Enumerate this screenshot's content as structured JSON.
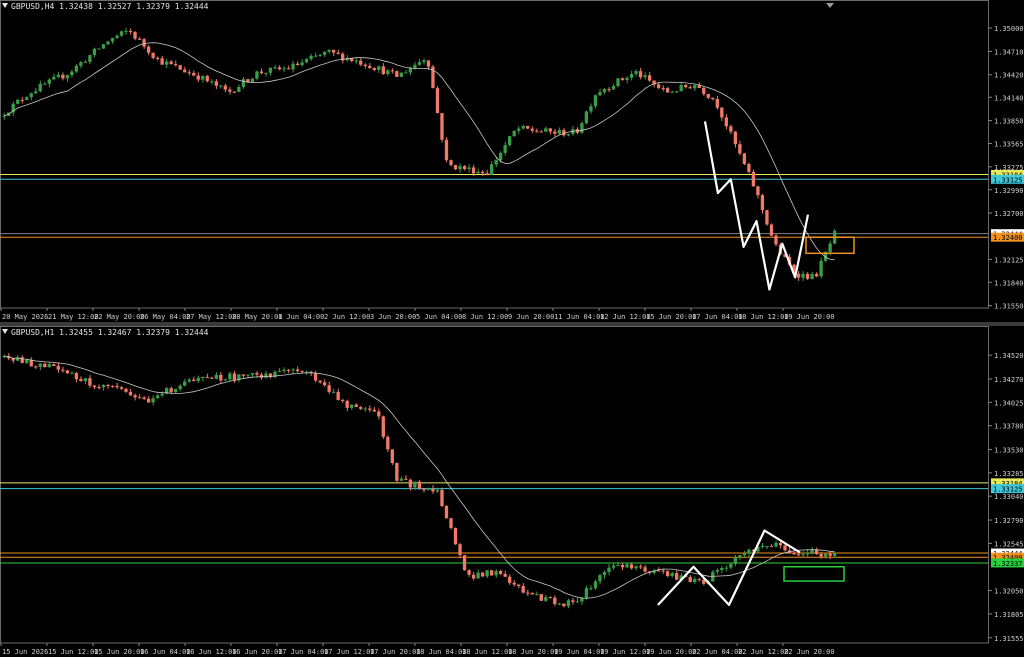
{
  "colors": {
    "background": "#000000",
    "bull": "#3a9e48",
    "bear": "#f07a67",
    "ma": "#c8c8c8",
    "axis_text": "#cfcfcf",
    "yellow": "#e8e85a",
    "cyan": "#3ec8d8",
    "orange": "#f0901e",
    "green": "#28d040",
    "white": "#ffffff"
  },
  "panes": [
    {
      "id": "h4",
      "header": "GBPUSD,H4  1.32438 1.32527 1.32379 1.32444",
      "symbol": "GBPUSD",
      "timeframe": "H4",
      "ohlc": [
        "1.32438",
        "1.32527",
        "1.32379",
        "1.32444"
      ],
      "y_min": 1.3152,
      "y_max": 1.352,
      "price_ticks": [
        "1.35000",
        "1.34710",
        "1.34420",
        "1.34140",
        "1.33850",
        "1.33565",
        "1.33275",
        "1.32990",
        "1.32700",
        "1.32125",
        "1.31840",
        "1.31550"
      ],
      "price_labels": [
        {
          "price": 1.3318,
          "text": "1.33184",
          "color": "#e8e85a"
        },
        {
          "price": 1.3312,
          "text": "1.33125",
          "color": "#3ec8d8"
        },
        {
          "price": 1.32444,
          "text": "1.32444",
          "color": "#ffffff"
        },
        {
          "price": 1.324,
          "text": "1.32400",
          "color": "#f0901e"
        }
      ],
      "hlines": [
        {
          "price": 1.3318,
          "color": "#e8e85a"
        },
        {
          "price": 1.3312,
          "color": "#3ec8d8"
        },
        {
          "price": 1.32444,
          "color": "#808080"
        },
        {
          "price": 1.324,
          "color": "#f0901e"
        }
      ],
      "time_labels": [
        "20 May 2026",
        "21 May 12:00",
        "22 May 20:00",
        "26 May 04:00",
        "27 May 12:00",
        "28 May 20:00",
        "1 Jun 04:00",
        "2 Jun 12:00",
        "3 Jun 20:00",
        "5 Jun 04:00",
        "8 Jun 12:00",
        "9 Jun 20:00",
        "11 Jun 04:00",
        "12 Jun 12:00",
        "15 Jun 20:00",
        "17 Jun 04:00",
        "18 Jun 12:00",
        "19 Jun 20:00"
      ],
      "zigzag": [
        [
          1.3384,
          0
        ],
        [
          1.3295,
          0
        ],
        [
          1.3312,
          0
        ],
        [
          1.3228,
          0
        ],
        [
          1.326,
          0
        ],
        [
          1.3175,
          0
        ],
        [
          1.3232,
          0
        ],
        [
          1.319,
          0
        ],
        [
          1.3268,
          0
        ]
      ],
      "target_box": {
        "top": 1.324,
        "bottom": 1.322,
        "color": "#f0901e"
      }
    },
    {
      "id": "h1",
      "header": "GBPUSD,H1  1.32455 1.32467 1.32379 1.32444",
      "symbol": "GBPUSD",
      "timeframe": "H1",
      "ohlc": [
        "1.32455",
        "1.32467",
        "1.32379",
        "1.32444"
      ],
      "y_min": 1.315,
      "y_max": 1.347,
      "price_ticks": [
        "1.34520",
        "1.34270",
        "1.34025",
        "1.33780",
        "1.33530",
        "1.33285",
        "1.33040",
        "1.32790",
        "1.32545",
        "1.32050",
        "1.31805",
        "1.31555"
      ],
      "price_labels": [
        {
          "price": 1.3318,
          "text": "1.33184",
          "color": "#e8e85a"
        },
        {
          "price": 1.3312,
          "text": "1.33125",
          "color": "#3ec8d8"
        },
        {
          "price": 1.32444,
          "text": "1.32444",
          "color": "#ffffff"
        },
        {
          "price": 1.324,
          "text": "1.32400",
          "color": "#f0901e"
        },
        {
          "price": 1.3234,
          "text": "1.32337",
          "color": "#28d040"
        }
      ],
      "hlines": [
        {
          "price": 1.3318,
          "color": "#e8e85a"
        },
        {
          "price": 1.3312,
          "color": "#3ec8d8"
        },
        {
          "price": 1.32444,
          "color": "#f0901e"
        },
        {
          "price": 1.324,
          "color": "#f0901e"
        },
        {
          "price": 1.3234,
          "color": "#28d040"
        }
      ],
      "time_labels": [
        "15 Jun 2026",
        "15 Jun 12:00",
        "15 Jun 20:00",
        "16 Jun 04:00",
        "16 Jun 12:00",
        "16 Jun 20:00",
        "17 Jun 04:00",
        "17 Jun 12:00",
        "17 Jun 20:00",
        "18 Jun 04:00",
        "18 Jun 12:00",
        "18 Jun 20:00",
        "19 Jun 04:00",
        "19 Jun 12:00",
        "19 Jun 20:00",
        "22 Jun 04:00",
        "22 Jun 12:00",
        "22 Jun 20:00"
      ],
      "zigzag": [
        [
          1.319,
          0
        ],
        [
          1.323,
          0
        ],
        [
          1.319,
          0
        ],
        [
          1.3268,
          0
        ],
        [
          1.3245,
          0
        ]
      ],
      "target_box": {
        "top": 1.323,
        "bottom": 1.3215,
        "color": "#28d040"
      }
    }
  ]
}
